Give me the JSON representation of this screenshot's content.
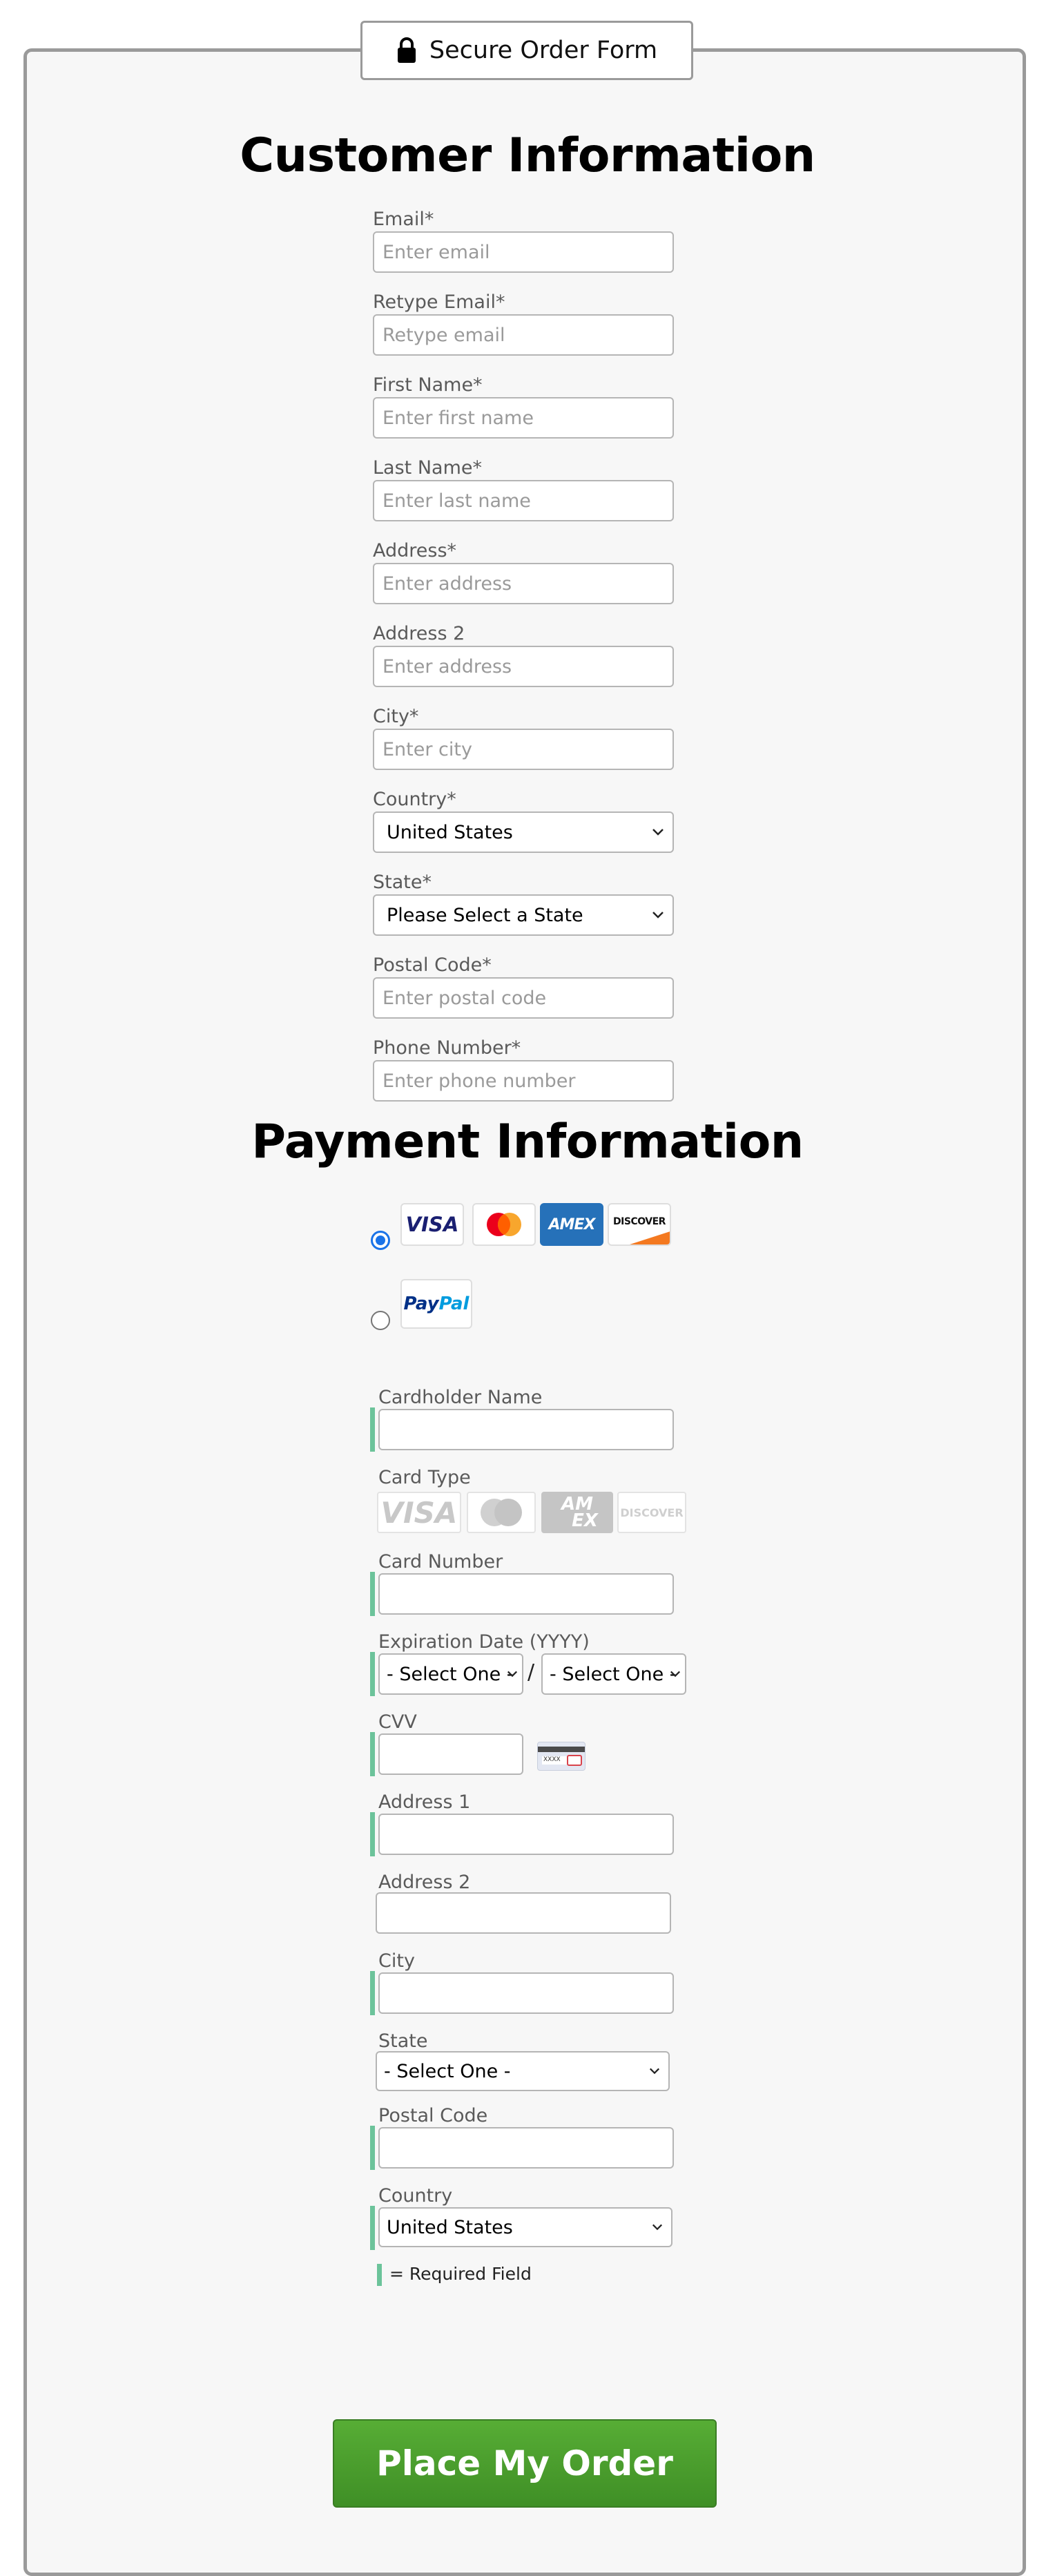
{
  "header": {
    "title": "Secure Order Form",
    "icon": "lock-icon"
  },
  "customer": {
    "heading": "Customer Information",
    "email": {
      "label": "Email*",
      "placeholder": "Enter email"
    },
    "retype_email": {
      "label": "Retype Email*",
      "placeholder": "Retype email"
    },
    "first_name": {
      "label": "First Name*",
      "placeholder": "Enter first name"
    },
    "last_name": {
      "label": "Last Name*",
      "placeholder": "Enter last name"
    },
    "address": {
      "label": "Address*",
      "placeholder": "Enter address"
    },
    "address2": {
      "label": "Address 2",
      "placeholder": "Enter address"
    },
    "city": {
      "label": "City*",
      "placeholder": "Enter city"
    },
    "country": {
      "label": "Country*",
      "value": "United States"
    },
    "state": {
      "label": "State*",
      "value": "Please Select a State"
    },
    "postal": {
      "label": "Postal Code*",
      "placeholder": "Enter postal code"
    },
    "phone": {
      "label": "Phone Number*",
      "placeholder": "Enter phone number"
    }
  },
  "payment": {
    "heading": "Payment Information",
    "methods": {
      "cards": [
        "VISA",
        "AMEX",
        "DISCOVER"
      ],
      "paypal": {
        "pay": "Pay",
        "pal": "Pal"
      }
    },
    "card_logos": [
      "VISA",
      "AM",
      "EX",
      "DISCOVER"
    ],
    "cardholder_label": "Cardholder Name",
    "card_type_label": "Card Type",
    "card_number_label": "Card Number",
    "expiration_label": "Expiration Date (YYYY)",
    "exp_month": "- Select One -",
    "exp_separator": "/",
    "exp_year": "- Select One -",
    "cvv_label": "CVV",
    "cvv_digits": "XXXX",
    "billing": {
      "address1_label": "Address 1",
      "address2_label": "Address 2",
      "city_label": "City",
      "state_label": "State",
      "state_value": "- Select One -",
      "postal_label": "Postal Code",
      "country_label": "Country",
      "country_value": "United States"
    },
    "required_note": "= Required Field"
  },
  "submit_label": "Place My Order",
  "colors": {
    "accent_green": "#4fa52f",
    "required_marker": "#6cc39a",
    "radio_blue": "#1a73e8"
  }
}
